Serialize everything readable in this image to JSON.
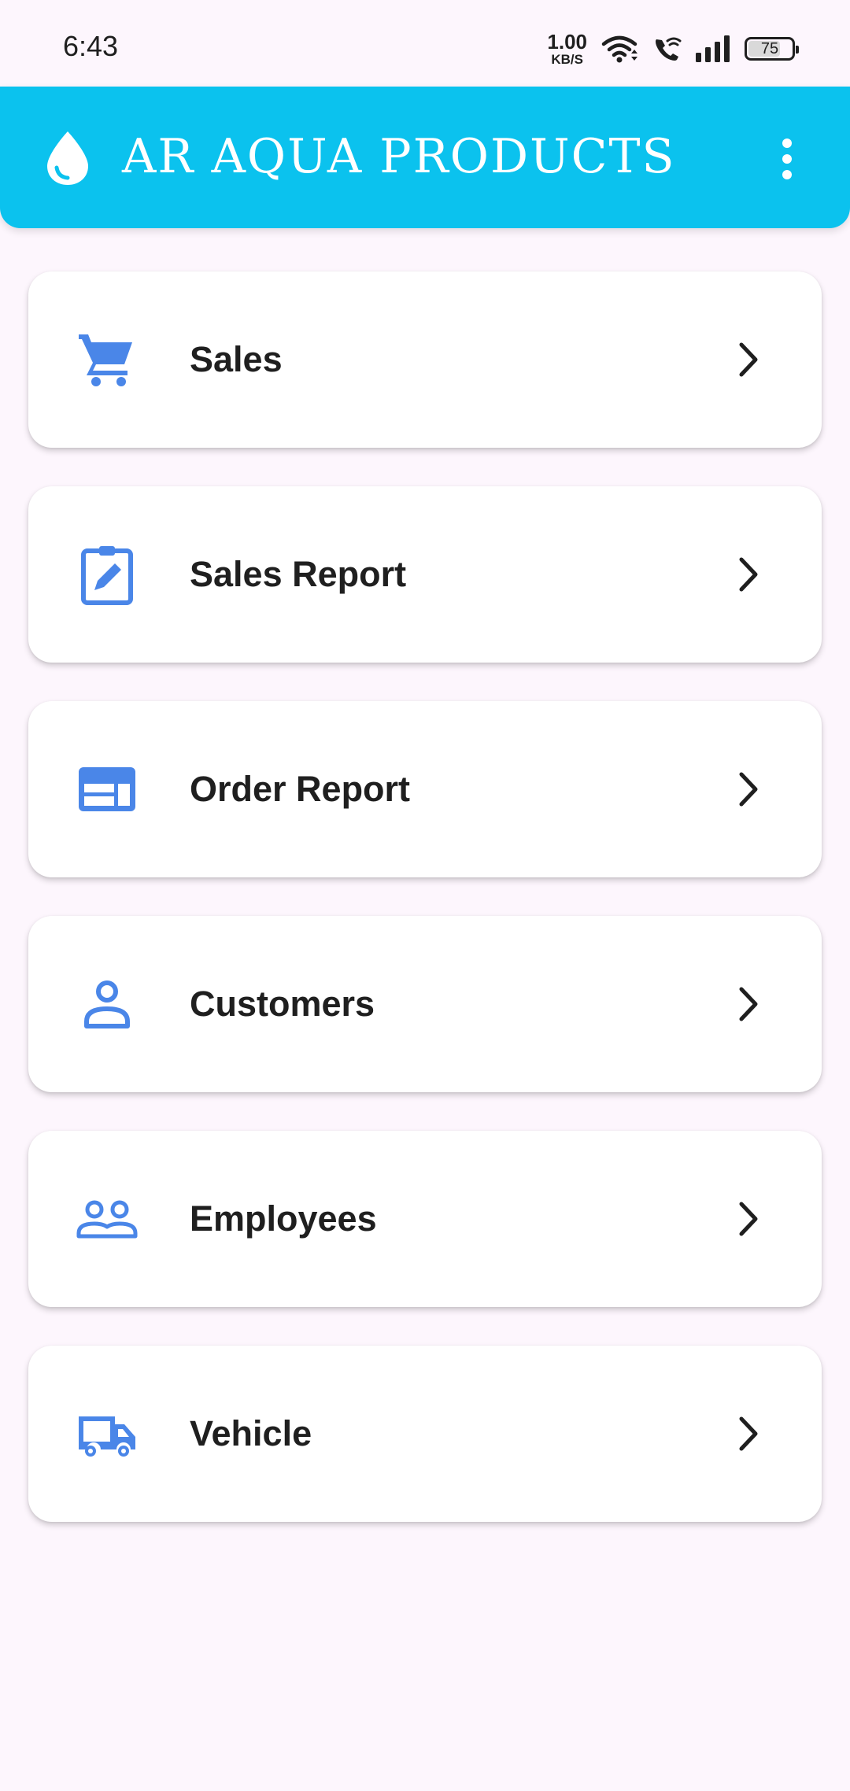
{
  "status_bar": {
    "time": "6:43",
    "net_speed_value": "1.00",
    "net_speed_unit": "KB/S",
    "battery_level": "75",
    "battery_fraction": 0.75
  },
  "app_bar": {
    "title": "AR AQUA PRODUCTS",
    "logo_icon": "water-drop-icon",
    "overflow_icon": "more-vert-icon",
    "background_color": "#0bc2ee"
  },
  "menu": {
    "accent_color": "#4a86e8",
    "items": [
      {
        "label": "Sales",
        "icon": "shopping-cart-icon"
      },
      {
        "label": "Sales Report",
        "icon": "clipboard-edit-icon"
      },
      {
        "label": "Order Report",
        "icon": "web-card-icon"
      },
      {
        "label": "Customers",
        "icon": "person-icon"
      },
      {
        "label": "Employees",
        "icon": "people-icon"
      },
      {
        "label": "Vehicle",
        "icon": "truck-icon"
      }
    ]
  }
}
